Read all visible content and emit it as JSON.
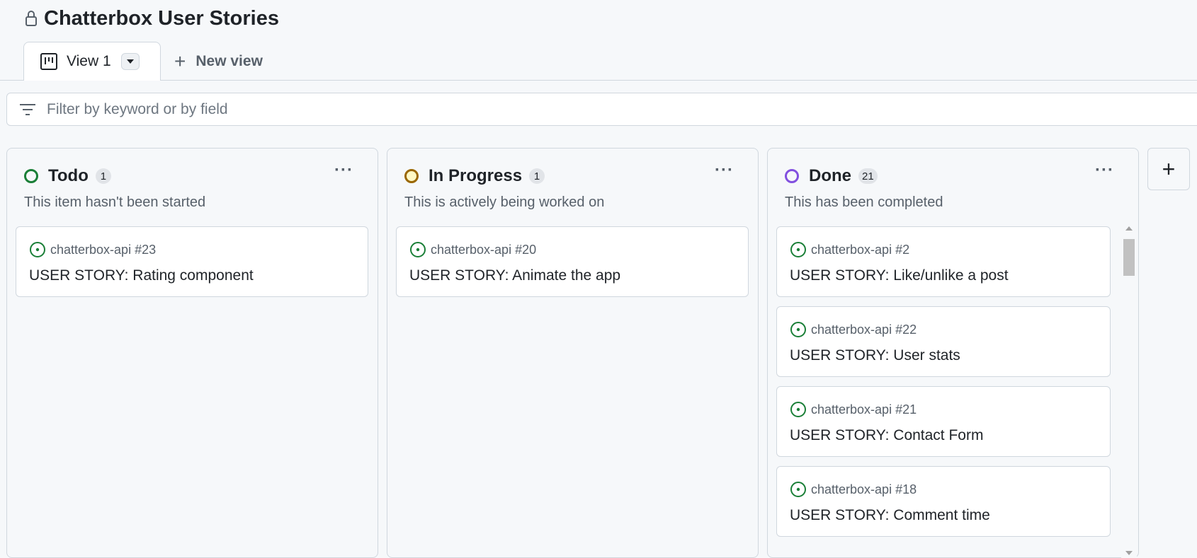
{
  "project": {
    "title": "Chatterbox User Stories",
    "lock_icon": "lock-icon"
  },
  "views": {
    "active_tab": {
      "label": "View 1",
      "icon": "project-board-icon"
    },
    "new_view_label": "New view"
  },
  "filter": {
    "placeholder": "Filter by keyword or by field",
    "icon": "filter-icon"
  },
  "colors": {
    "todo": "#1a7f37",
    "in_progress": "#9a6700",
    "in_progress_fill": "#fff8c5",
    "done": "#8250df",
    "issue_open": "#1a7f37"
  },
  "columns": [
    {
      "name": "Todo",
      "count": "1",
      "description": "This item hasn't been started",
      "cards": [
        {
          "ref": "chatterbox-api #23",
          "title": "USER STORY: Rating component"
        }
      ]
    },
    {
      "name": "In Progress",
      "count": "1",
      "description": "This is actively being worked on",
      "cards": [
        {
          "ref": "chatterbox-api #20",
          "title": "USER STORY: Animate the app"
        }
      ]
    },
    {
      "name": "Done",
      "count": "21",
      "description": "This has been completed",
      "cards": [
        {
          "ref": "chatterbox-api #2",
          "title": "USER STORY: Like/unlike a post"
        },
        {
          "ref": "chatterbox-api #22",
          "title": "USER STORY: User stats"
        },
        {
          "ref": "chatterbox-api #21",
          "title": "USER STORY: Contact Form"
        },
        {
          "ref": "chatterbox-api #18",
          "title": "USER STORY: Comment time"
        }
      ]
    }
  ],
  "column_menu_icon": "kebab-horizontal-icon",
  "add_column_icon": "plus-icon"
}
